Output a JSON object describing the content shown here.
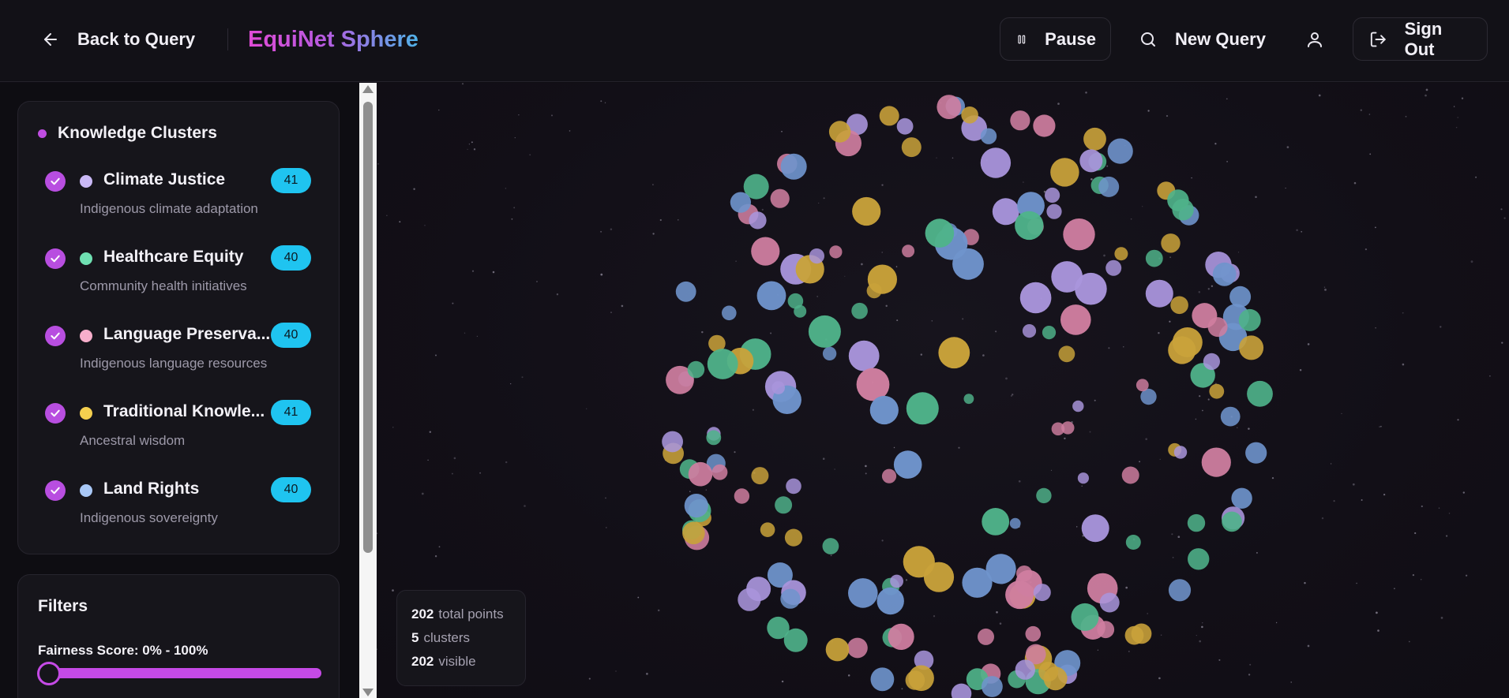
{
  "header": {
    "back_label": "Back to Query",
    "brand": "EquiNet Sphere",
    "pause_label": "Pause",
    "new_query_label": "New Query",
    "sign_out_label": "Sign Out"
  },
  "clusters_panel": {
    "title": "Knowledge Clusters",
    "items": [
      {
        "name": "Climate Justice",
        "count": "41",
        "desc": "Indigenous climate adaptation",
        "color": "#a995dc"
      },
      {
        "name": "Healthcare Equity",
        "count": "40",
        "desc": "Community health initiatives",
        "color": "#4fb38a"
      },
      {
        "name": "Language Preserva...",
        "count": "40",
        "desc": "Indigenous language resources",
        "color": "#cf7ea0"
      },
      {
        "name": "Traditional Knowle...",
        "count": "41",
        "desc": "Ancestral wisdom",
        "color": "#c9a23a"
      },
      {
        "name": "Land Rights",
        "count": "40",
        "desc": "Indigenous sovereignty",
        "color": "#6f94cc"
      }
    ]
  },
  "filters": {
    "title": "Filters",
    "fairness_label": "Fairness Score: 0% - 100%",
    "fairness_min": 0,
    "fairness_max": 100
  },
  "stats": {
    "total_points": "202",
    "total_points_label": "total points",
    "clusters": "5",
    "clusters_label": "clusters",
    "visible": "202",
    "visible_label": "visible"
  },
  "icons": [
    "arrow-left-icon",
    "pause-icon",
    "search-icon",
    "user-icon",
    "sign-out-icon",
    "check-icon"
  ],
  "colors": {
    "accent": "#c04de2",
    "badge": "#1fc4f0",
    "background": "#0f0d13"
  }
}
